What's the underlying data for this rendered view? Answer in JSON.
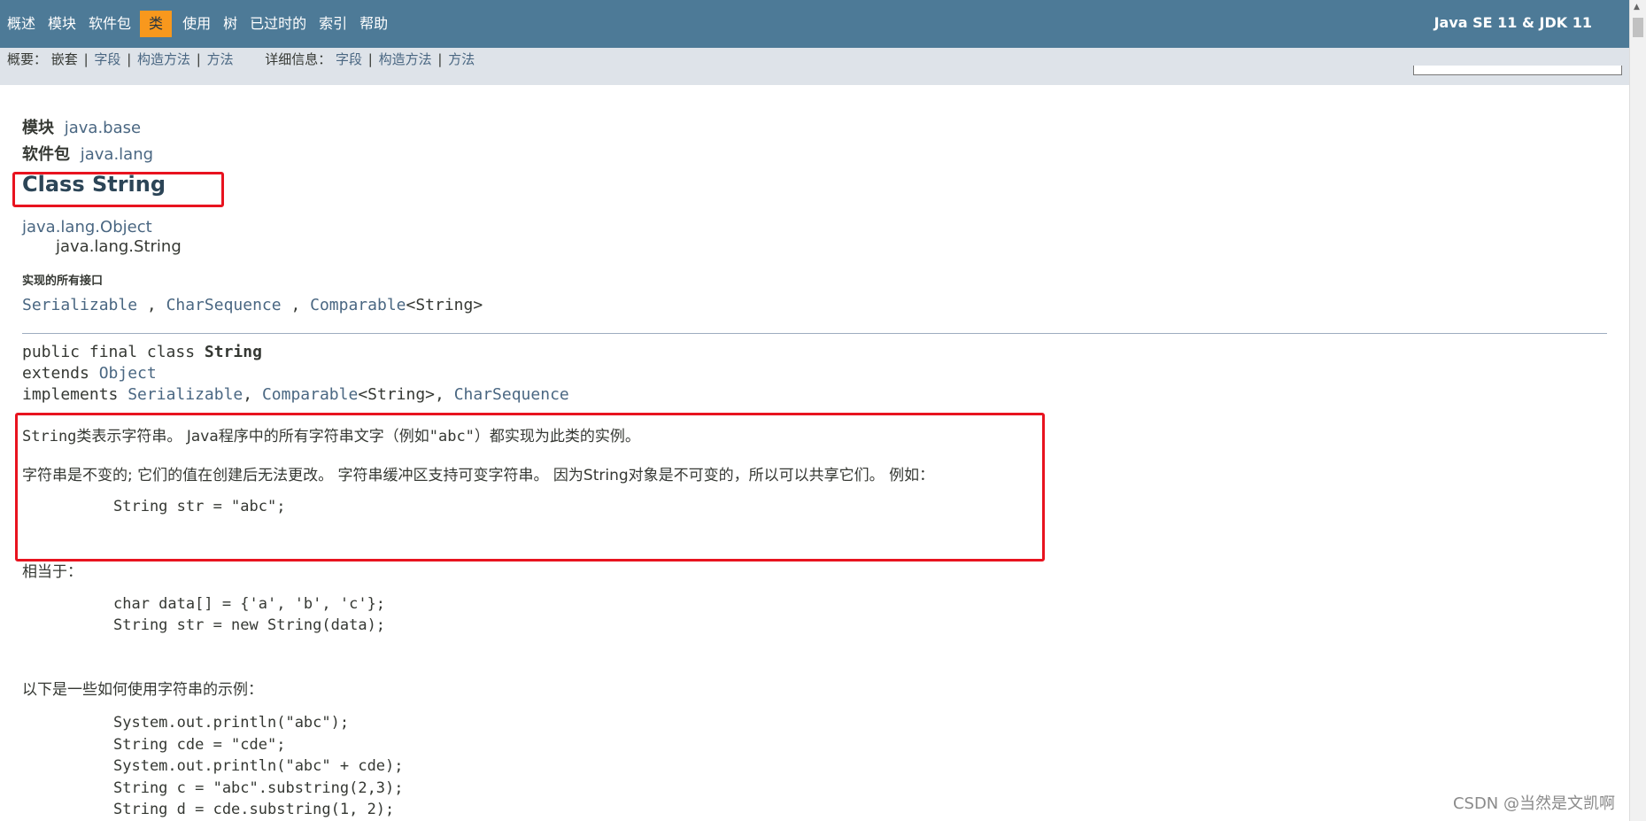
{
  "nav": {
    "items": [
      "概述",
      "模块",
      "软件包",
      "类",
      "使用",
      "树",
      "已过时的",
      "索引",
      "帮助"
    ],
    "active": "类",
    "brand": "Java SE 11 & JDK 11"
  },
  "subnav": {
    "summary_label": "概要：",
    "summary_items": [
      "嵌套",
      "字段",
      "构造方法",
      "方法"
    ],
    "detail_label": "详细信息：",
    "detail_items": [
      "字段",
      "构造方法",
      "方法"
    ]
  },
  "header": {
    "module_label": "模块",
    "module_value": "java.base",
    "package_label": "软件包",
    "package_value": "java.lang",
    "title": "Class String"
  },
  "inheritance": {
    "parent": "java.lang.Object",
    "self": "java.lang.String"
  },
  "interfaces": {
    "heading": "实现的所有接口",
    "items": [
      "Serializable",
      "CharSequence",
      "Comparable"
    ],
    "generic_suffix": "<String>"
  },
  "signature": {
    "line1_prefix": "public final class ",
    "line1_name": "String",
    "line2_prefix": "extends ",
    "line2_link": "Object",
    "line3_prefix": "implements ",
    "line3_links": [
      "Serializable",
      "Comparable",
      "CharSequence"
    ]
  },
  "description": {
    "p1_code": "String",
    "p1_text": "类表示字符串。 Java程序中的所有字符串文字（例如",
    "p1_code2": "\"abc\"",
    "p1_text2": "）都实现为此类的实例。",
    "p2": "字符串是不变的; 它们的值在创建后无法更改。 字符串缓冲区支持可变字符串。 因为String对象是不可变的，所以可以共享它们。 例如：",
    "code1": "String str = \"abc\";",
    "p3": "相当于：",
    "code2": "char data[] = {'a', 'b', 'c'};\nString str = new String(data);",
    "p4": "以下是一些如何使用字符串的示例：",
    "code3": "System.out.println(\"abc\");\nString cde = \"cde\";\nSystem.out.println(\"abc\" + cde);\nString c = \"abc\".substring(2,3);\nString d = cde.substring(1, 2);"
  },
  "watermark": "CSDN @当然是文凯啊",
  "colors": {
    "nav": "#4d7a97",
    "active": "#f8981d",
    "link": "#4a6782",
    "highlight": "#e8131f"
  }
}
